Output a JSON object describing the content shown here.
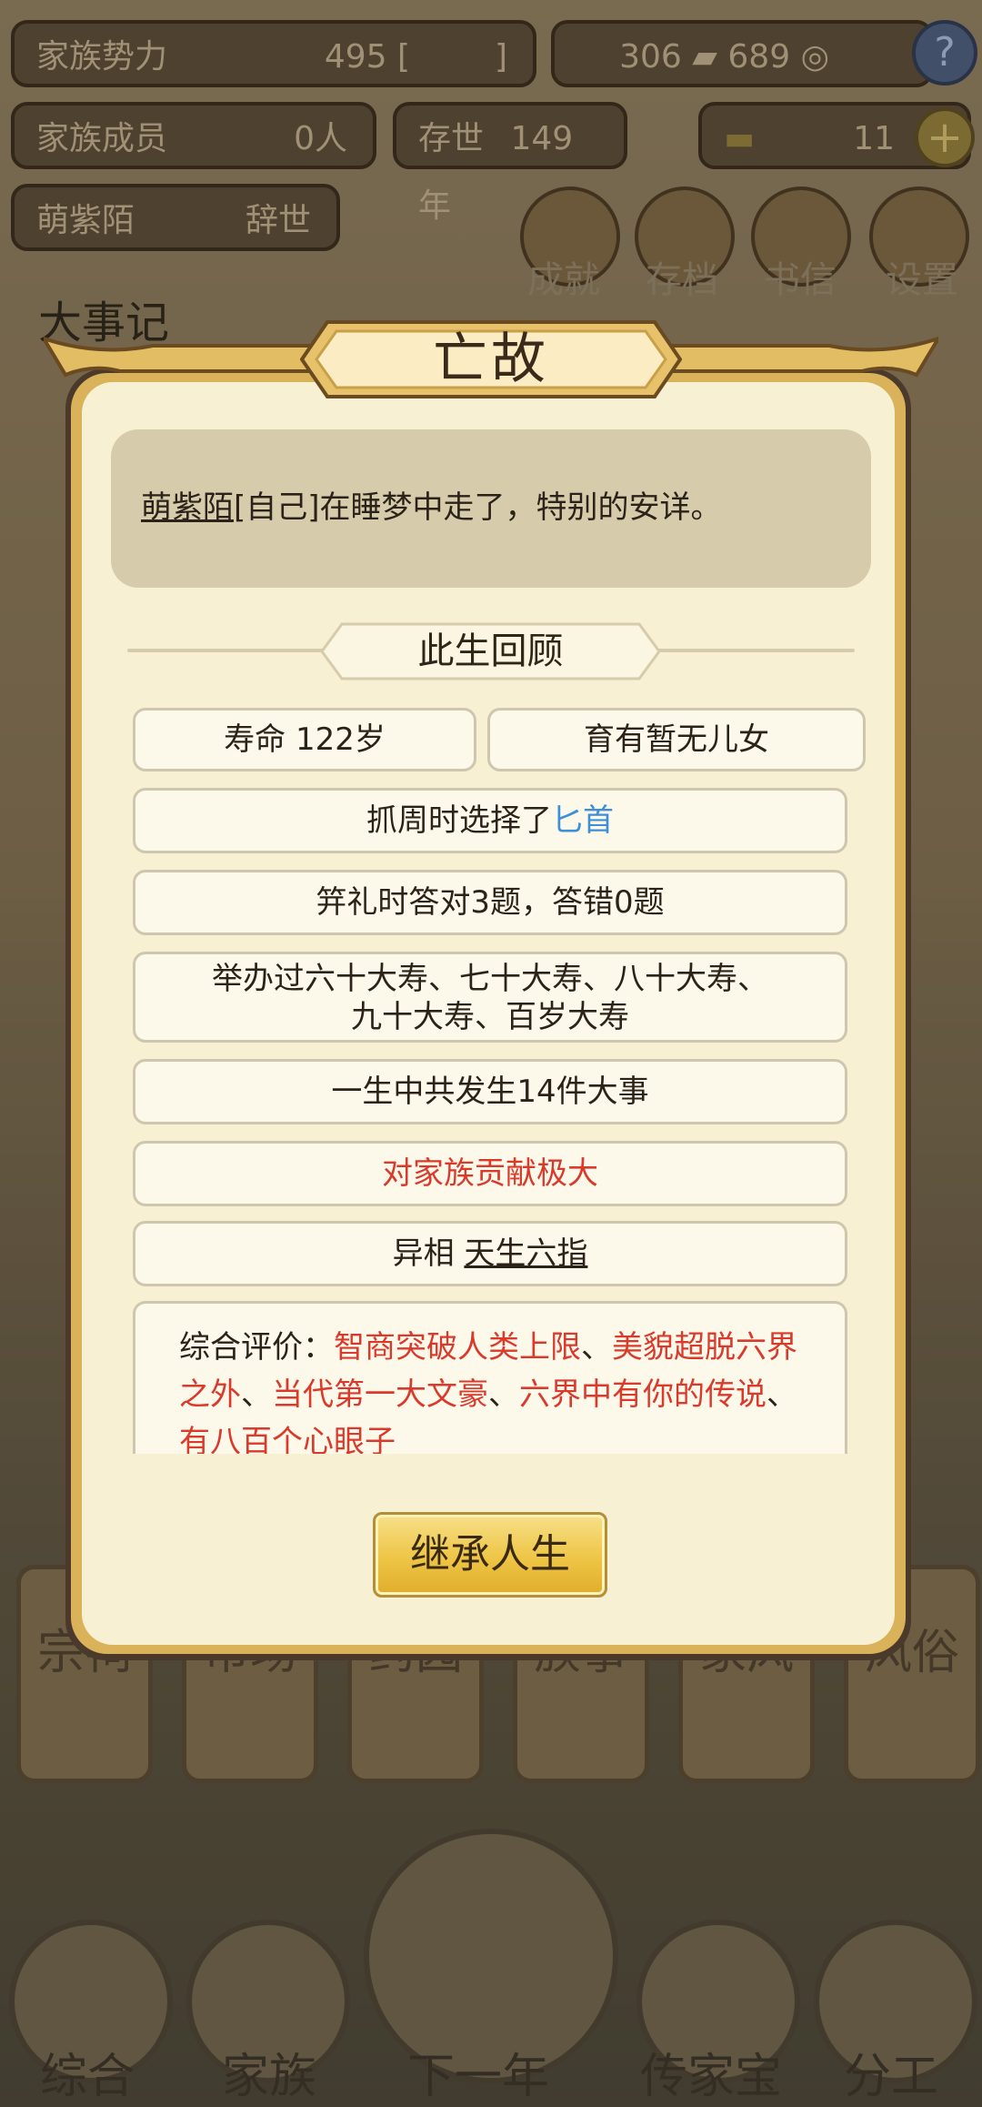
{
  "header": {
    "power_label": "家族势力",
    "power_value": "495",
    "power_bracket_open": "[",
    "power_bracket_close": "]",
    "currency1": "306",
    "currency2": "689",
    "members_label": "家族成员",
    "members_value": "0人",
    "existence_label": "存世",
    "existence_value": "149年",
    "gold_value": "11",
    "person_name": "萌紫陌",
    "person_status": "辞世"
  },
  "top_buttons": [
    {
      "label": "成就"
    },
    {
      "label": "存档"
    },
    {
      "label": "书信"
    },
    {
      "label": "设置"
    }
  ],
  "background": {
    "chronicle_title": "大事记",
    "pillars": [
      "宗祠",
      "市场",
      "药园",
      "族事",
      "家风",
      "风俗"
    ],
    "bottom_nav": [
      "综合",
      "家族",
      "下一年",
      "传家宝",
      "分工"
    ]
  },
  "dialog": {
    "title": "亡故",
    "description_name": "萌紫陌",
    "description_rest": "[自己]在睡梦中走了，特别的安详。",
    "section_title": "此生回顾",
    "lifespan": "寿命 122岁",
    "children": "育有暂无儿女",
    "grab_prefix": "抓周时选择了",
    "grab_item": "匕首",
    "ceremony": "笄礼时答对3题，答错0题",
    "birthdays_line1": "举办过六十大寿、七十大寿、八十大寿、",
    "birthdays_line2": "九十大寿、百岁大寿",
    "events": "一生中共发生14件大事",
    "contribution": "对家族贡献极大",
    "trait_prefix": "异相",
    "trait_value": "天生六指",
    "summary_label": "综合评价：",
    "summary_items": [
      "智商突破人类上限",
      "美貌超脱六界之外",
      "当代第一大文豪",
      "六界中有你的传说",
      "有八百个心眼子"
    ],
    "separator": "、",
    "button_label": "继承人生"
  },
  "colors": {
    "panel": "#f8f0d2",
    "gold": "#d9b25a",
    "blue_text": "#3c8fd8",
    "red_text": "#d93a2c"
  }
}
